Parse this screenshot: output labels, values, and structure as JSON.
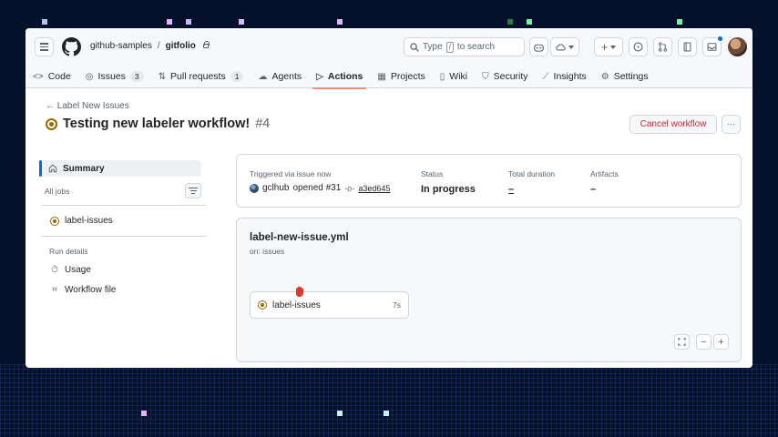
{
  "header": {
    "owner": "github-samples",
    "separator": "/",
    "repo": "gitfolio",
    "search_prefix": "Type",
    "search_key": "/",
    "search_suffix": "to search"
  },
  "tabs": [
    {
      "label": "Code",
      "icon": "code-icon"
    },
    {
      "label": "Issues",
      "icon": "issue-icon",
      "count": "3"
    },
    {
      "label": "Pull requests",
      "icon": "pull-request-icon",
      "count": "1"
    },
    {
      "label": "Agents",
      "icon": "agent-icon"
    },
    {
      "label": "Actions",
      "icon": "play-icon",
      "active": true
    },
    {
      "label": "Projects",
      "icon": "table-icon"
    },
    {
      "label": "Wiki",
      "icon": "book-icon"
    },
    {
      "label": "Security",
      "icon": "shield-icon"
    },
    {
      "label": "Insights",
      "icon": "graph-icon"
    },
    {
      "label": "Settings",
      "icon": "gear-icon"
    }
  ],
  "run": {
    "back_label": "Label New Issues",
    "title": "Testing new labeler workflow!",
    "number": "#4",
    "cancel_label": "Cancel workflow",
    "more_label": "···"
  },
  "sidebar": {
    "summary_label": "Summary",
    "all_jobs_label": "All jobs",
    "job_label": "label-issues",
    "run_details_label": "Run details",
    "usage_label": "Usage",
    "workflow_file_label": "Workflow file"
  },
  "summary": {
    "trigger_label": "Triggered via issue now",
    "actor": "gclhub",
    "trigger_action": "opened #31",
    "commit": "a3ed645",
    "status_label": "Status",
    "status_value": "In progress",
    "duration_label": "Total duration",
    "duration_value": "–",
    "artifacts_label": "Artifacts",
    "artifacts_value": "–"
  },
  "workflow": {
    "file_name": "label-new-issue.yml",
    "trigger": "on: issues",
    "job_name": "label-issues",
    "job_time": "7s"
  },
  "colors": {
    "accent": "#0969da",
    "in_progress": "#9a6700",
    "danger": "#d1242f",
    "tab_underline": "#fd8c73"
  }
}
